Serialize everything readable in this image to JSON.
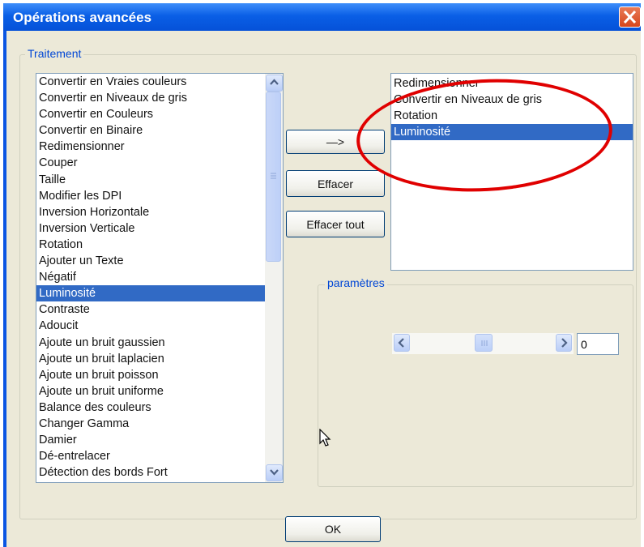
{
  "window": {
    "title": "Opérations avancées",
    "close_icon": "close-icon",
    "accent": "#0a55e3"
  },
  "traitement": {
    "legend": "Traitement",
    "items": [
      "Convertir en Vraies couleurs",
      "Convertir en Niveaux de gris",
      "Convertir en Couleurs",
      "Convertir en Binaire",
      "Redimensionner",
      "Couper",
      "Taille",
      "Modifier les DPI",
      "Inversion Horizontale",
      "Inversion Verticale",
      "Rotation",
      "Ajouter un Texte",
      "Négatif",
      "Luminosité",
      "Contraste",
      "Adoucit",
      "Ajoute un bruit gaussien",
      "Ajoute un bruit laplacien",
      "Ajoute un bruit poisson",
      "Ajoute un bruit uniforme",
      "Balance des couleurs",
      "Changer Gamma",
      "Damier",
      "Dé-entrelacer",
      "Détection des bords Fort"
    ],
    "selected_item": "Luminosité",
    "scroll_up_icon": "chevron-up-icon",
    "scroll_down_icon": "chevron-down-icon"
  },
  "buttons": {
    "add": "—>",
    "effacer": "Effacer",
    "effacer_tout": "Effacer tout",
    "ok": "OK"
  },
  "selected_operations": {
    "items": [
      "Redimensionner",
      "Convertir en Niveaux de gris",
      "Rotation",
      "Luminosité"
    ],
    "selected_item": "Luminosité"
  },
  "parametres": {
    "legend": "paramètres",
    "slider_value": "0",
    "slider_left_icon": "chevron-left-icon",
    "slider_right_icon": "chevron-right-icon"
  },
  "annotation": {
    "color": "#e00000",
    "shape": "ellipse"
  },
  "cursor_icon": "mouse-pointer-icon"
}
